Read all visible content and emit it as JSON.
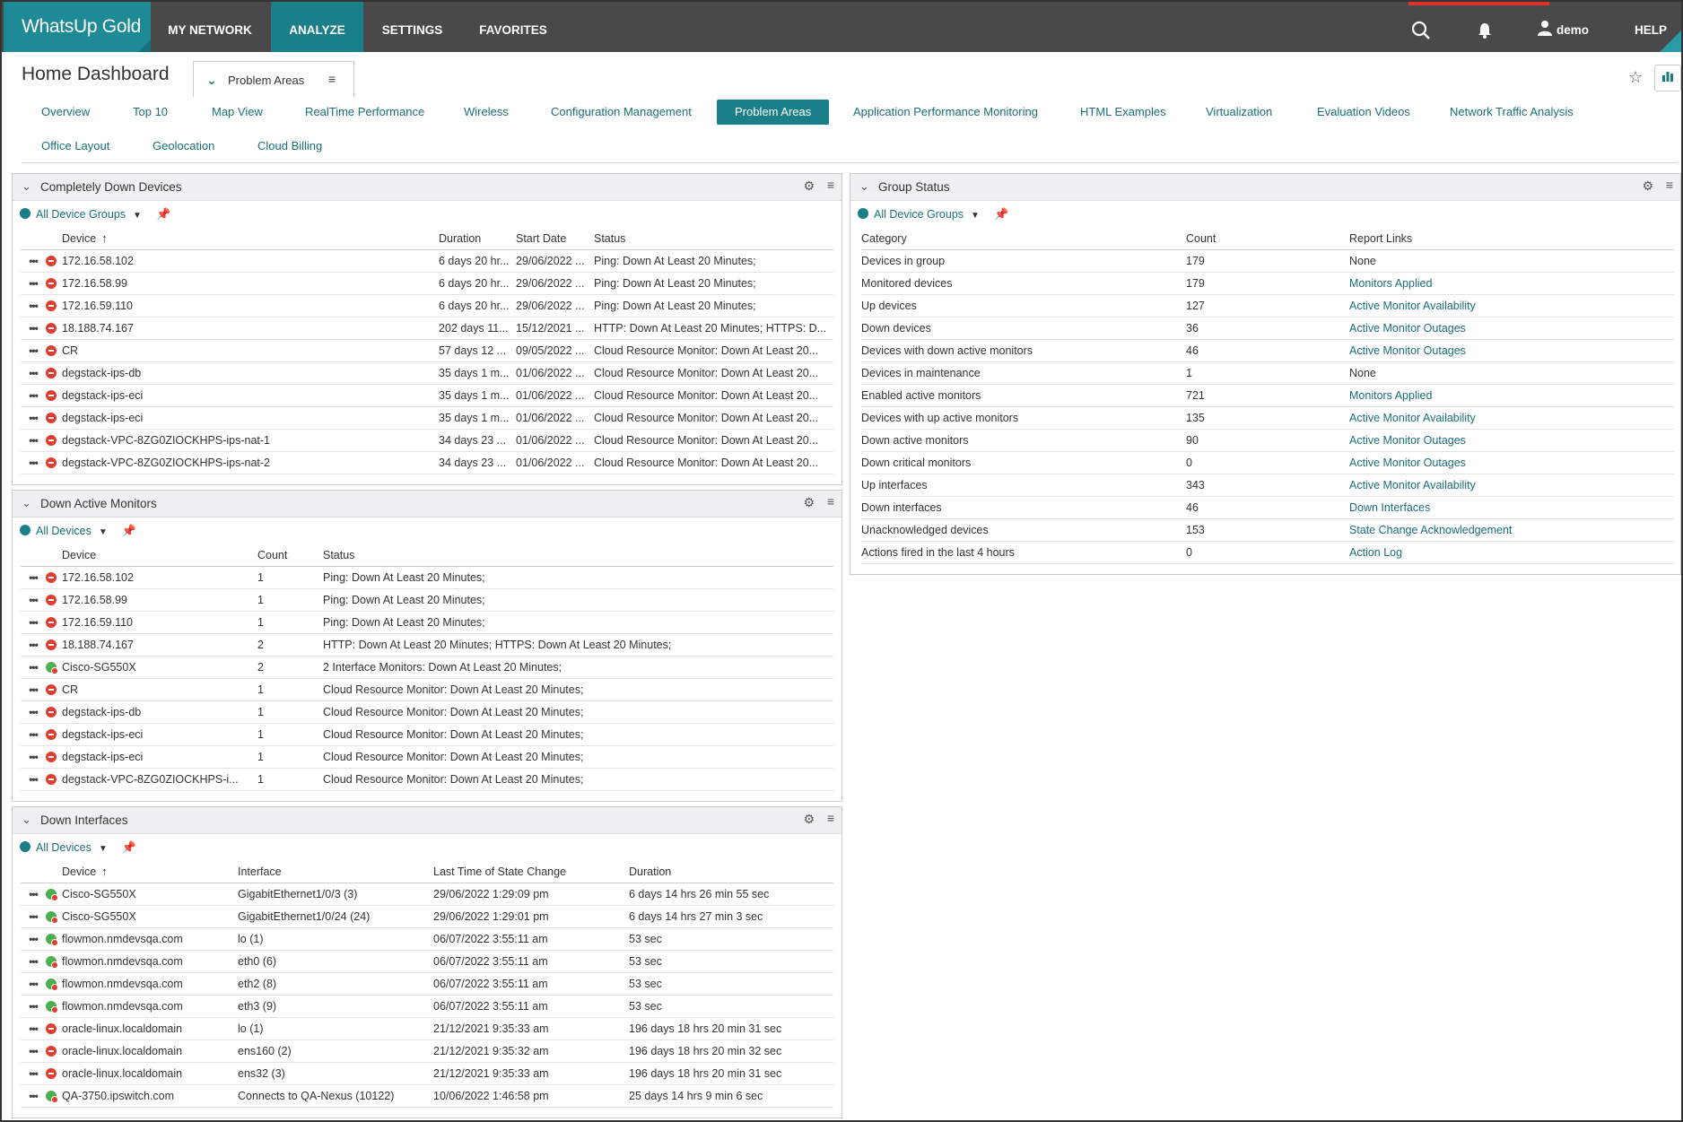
{
  "app": {
    "logo": "WhatsUp Gold",
    "nav": [
      "MY NETWORK",
      "ANALYZE",
      "SETTINGS",
      "FAVORITES"
    ],
    "active_nav": "ANALYZE",
    "user": "demo",
    "help": "HELP"
  },
  "header": {
    "title": "Home Dashboard",
    "dashboard_select": "Problem Areas"
  },
  "tabs": [
    "Overview",
    "Top 10",
    "Map View",
    "RealTime Performance",
    "Wireless",
    "Configuration Management",
    "Problem Areas",
    "Application Performance Monitoring",
    "HTML Examples",
    "Virtualization",
    "Evaluation Videos",
    "Network Traffic Analysis",
    "Office Layout",
    "Geolocation",
    "Cloud Billing"
  ],
  "active_tab": "Problem Areas",
  "down_devices": {
    "title": "Completely Down Devices",
    "filter": "All Device Groups",
    "columns": [
      "Device",
      "Duration",
      "Start Date",
      "Status"
    ],
    "rows": [
      {
        "state": "down",
        "device": "172.16.58.102",
        "duration": "6 days 20 hr...",
        "start": "29/06/2022 ...",
        "status": "Ping: Down At Least 20 Minutes;"
      },
      {
        "state": "down",
        "device": "172.16.58.99",
        "duration": "6 days 20 hr...",
        "start": "29/06/2022 ...",
        "status": "Ping: Down At Least 20 Minutes;"
      },
      {
        "state": "down",
        "device": "172.16.59.110",
        "duration": "6 days 20 hr...",
        "start": "29/06/2022 ...",
        "status": "Ping: Down At Least 20 Minutes;"
      },
      {
        "state": "down",
        "device": "18.188.74.167",
        "duration": "202 days 11...",
        "start": "15/12/2021 ...",
        "status": "HTTP: Down At Least 20 Minutes; HTTPS: D..."
      },
      {
        "state": "down",
        "device": "CR",
        "duration": "57 days 12 ...",
        "start": "09/05/2022 ...",
        "status": "Cloud Resource Monitor: Down At Least 20..."
      },
      {
        "state": "down",
        "device": "degstack-ips-db",
        "duration": "35 days 1 m...",
        "start": "01/06/2022 ...",
        "status": "Cloud Resource Monitor: Down At Least 20..."
      },
      {
        "state": "down",
        "device": "degstack-ips-eci",
        "duration": "35 days 1 m...",
        "start": "01/06/2022 ...",
        "status": "Cloud Resource Monitor: Down At Least 20..."
      },
      {
        "state": "down",
        "device": "degstack-ips-eci",
        "duration": "35 days 1 m...",
        "start": "01/06/2022 ...",
        "status": "Cloud Resource Monitor: Down At Least 20..."
      },
      {
        "state": "down",
        "device": "degstack-VPC-8ZG0ZIOCKHPS-ips-nat-1",
        "duration": "34 days 23 ...",
        "start": "01/06/2022 ...",
        "status": "Cloud Resource Monitor: Down At Least 20..."
      },
      {
        "state": "down",
        "device": "degstack-VPC-8ZG0ZIOCKHPS-ips-nat-2",
        "duration": "34 days 23 ...",
        "start": "01/06/2022 ...",
        "status": "Cloud Resource Monitor: Down At Least 20..."
      }
    ]
  },
  "down_monitors": {
    "title": "Down Active Monitors",
    "filter": "All Devices",
    "columns": [
      "Device",
      "Count",
      "Status"
    ],
    "rows": [
      {
        "state": "down",
        "device": "172.16.58.102",
        "count": "1",
        "status": "Ping: Down At Least 20 Minutes;"
      },
      {
        "state": "down",
        "device": "172.16.58.99",
        "count": "1",
        "status": "Ping: Down At Least 20 Minutes;"
      },
      {
        "state": "down",
        "device": "172.16.59.110",
        "count": "1",
        "status": "Ping: Down At Least 20 Minutes;"
      },
      {
        "state": "down",
        "device": "18.188.74.167",
        "count": "2",
        "status": "HTTP: Down At Least 20 Minutes; HTTPS: Down At Least 20 Minutes;"
      },
      {
        "state": "up",
        "device": "Cisco-SG550X",
        "count": "2",
        "status": "2 Interface Monitors: Down At Least 20 Minutes;"
      },
      {
        "state": "down",
        "device": "CR",
        "count": "1",
        "status": "Cloud Resource Monitor: Down At Least 20 Minutes;"
      },
      {
        "state": "down",
        "device": "degstack-ips-db",
        "count": "1",
        "status": "Cloud Resource Monitor: Down At Least 20 Minutes;"
      },
      {
        "state": "down",
        "device": "degstack-ips-eci",
        "count": "1",
        "status": "Cloud Resource Monitor: Down At Least 20 Minutes;"
      },
      {
        "state": "down",
        "device": "degstack-ips-eci",
        "count": "1",
        "status": "Cloud Resource Monitor: Down At Least 20 Minutes;"
      },
      {
        "state": "down",
        "device": "degstack-VPC-8ZG0ZIOCKHPS-i...",
        "count": "1",
        "status": "Cloud Resource Monitor: Down At Least 20 Minutes;"
      }
    ]
  },
  "down_interfaces": {
    "title": "Down Interfaces",
    "filter": "All Devices",
    "columns": [
      "Device",
      "Interface",
      "Last Time of State Change",
      "Duration"
    ],
    "rows": [
      {
        "state": "up",
        "device": "Cisco-SG550X",
        "iface": "GigabitEthernet1/0/3 (3)",
        "changed": "29/06/2022 1:29:09 pm",
        "duration": "6 days 14 hrs 26 min 55 sec"
      },
      {
        "state": "up",
        "device": "Cisco-SG550X",
        "iface": "GigabitEthernet1/0/24 (24)",
        "changed": "29/06/2022 1:29:01 pm",
        "duration": "6 days 14 hrs 27 min 3 sec"
      },
      {
        "state": "up",
        "device": "flowmon.nmdevsqa.com",
        "iface": "lo (1)",
        "changed": "06/07/2022 3:55:11 am",
        "duration": "53 sec"
      },
      {
        "state": "up",
        "device": "flowmon.nmdevsqa.com",
        "iface": "eth0 (6)",
        "changed": "06/07/2022 3:55:11 am",
        "duration": "53 sec"
      },
      {
        "state": "up",
        "device": "flowmon.nmdevsqa.com",
        "iface": "eth2 (8)",
        "changed": "06/07/2022 3:55:11 am",
        "duration": "53 sec"
      },
      {
        "state": "up",
        "device": "flowmon.nmdevsqa.com",
        "iface": "eth3 (9)",
        "changed": "06/07/2022 3:55:11 am",
        "duration": "53 sec"
      },
      {
        "state": "down",
        "device": "oracle-linux.localdomain",
        "iface": "lo (1)",
        "changed": "21/12/2021 9:35:33 am",
        "duration": "196 days 18 hrs 20 min 31 sec"
      },
      {
        "state": "down",
        "device": "oracle-linux.localdomain",
        "iface": "ens160 (2)",
        "changed": "21/12/2021 9:35:32 am",
        "duration": "196 days 18 hrs 20 min 32 sec"
      },
      {
        "state": "down",
        "device": "oracle-linux.localdomain",
        "iface": "ens32 (3)",
        "changed": "21/12/2021 9:35:33 am",
        "duration": "196 days 18 hrs 20 min 31 sec"
      },
      {
        "state": "up",
        "device": "QA-3750.ipswitch.com",
        "iface": "Connects to QA-Nexus (10122)",
        "changed": "10/06/2022 1:46:58 pm",
        "duration": "25 days 14 hrs 9 min 6 sec"
      }
    ]
  },
  "group_status": {
    "title": "Group Status",
    "filter": "All Device Groups",
    "columns": [
      "Category",
      "Count",
      "Report Links"
    ],
    "rows": [
      {
        "category": "Devices in group",
        "count": "179",
        "link": "None",
        "is_link": false
      },
      {
        "category": "Monitored devices",
        "count": "179",
        "link": "Monitors Applied",
        "is_link": true
      },
      {
        "category": "Up devices",
        "count": "127",
        "link": "Active Monitor Availability",
        "is_link": true
      },
      {
        "category": "Down devices",
        "count": "36",
        "link": "Active Monitor Outages",
        "is_link": true
      },
      {
        "category": "Devices with down active monitors",
        "count": "46",
        "link": "Active Monitor Outages",
        "is_link": true
      },
      {
        "category": "Devices in maintenance",
        "count": "1",
        "link": "None",
        "is_link": false
      },
      {
        "category": "Enabled active monitors",
        "count": "721",
        "link": "Monitors Applied",
        "is_link": true
      },
      {
        "category": "Devices with up active monitors",
        "count": "135",
        "link": "Active Monitor Availability",
        "is_link": true
      },
      {
        "category": "Down active monitors",
        "count": "90",
        "link": "Active Monitor Outages",
        "is_link": true
      },
      {
        "category": "Down critical monitors",
        "count": "0",
        "link": "Active Monitor Outages",
        "is_link": true
      },
      {
        "category": "Up interfaces",
        "count": "343",
        "link": "Active Monitor Availability",
        "is_link": true
      },
      {
        "category": "Down interfaces",
        "count": "46",
        "link": "Down Interfaces",
        "is_link": true
      },
      {
        "category": "Unacknowledged devices",
        "count": "153",
        "link": "State Change Acknowledgement",
        "is_link": true
      },
      {
        "category": "Actions fired in the last 4 hours",
        "count": "0",
        "link": "Action Log",
        "is_link": true
      }
    ]
  }
}
